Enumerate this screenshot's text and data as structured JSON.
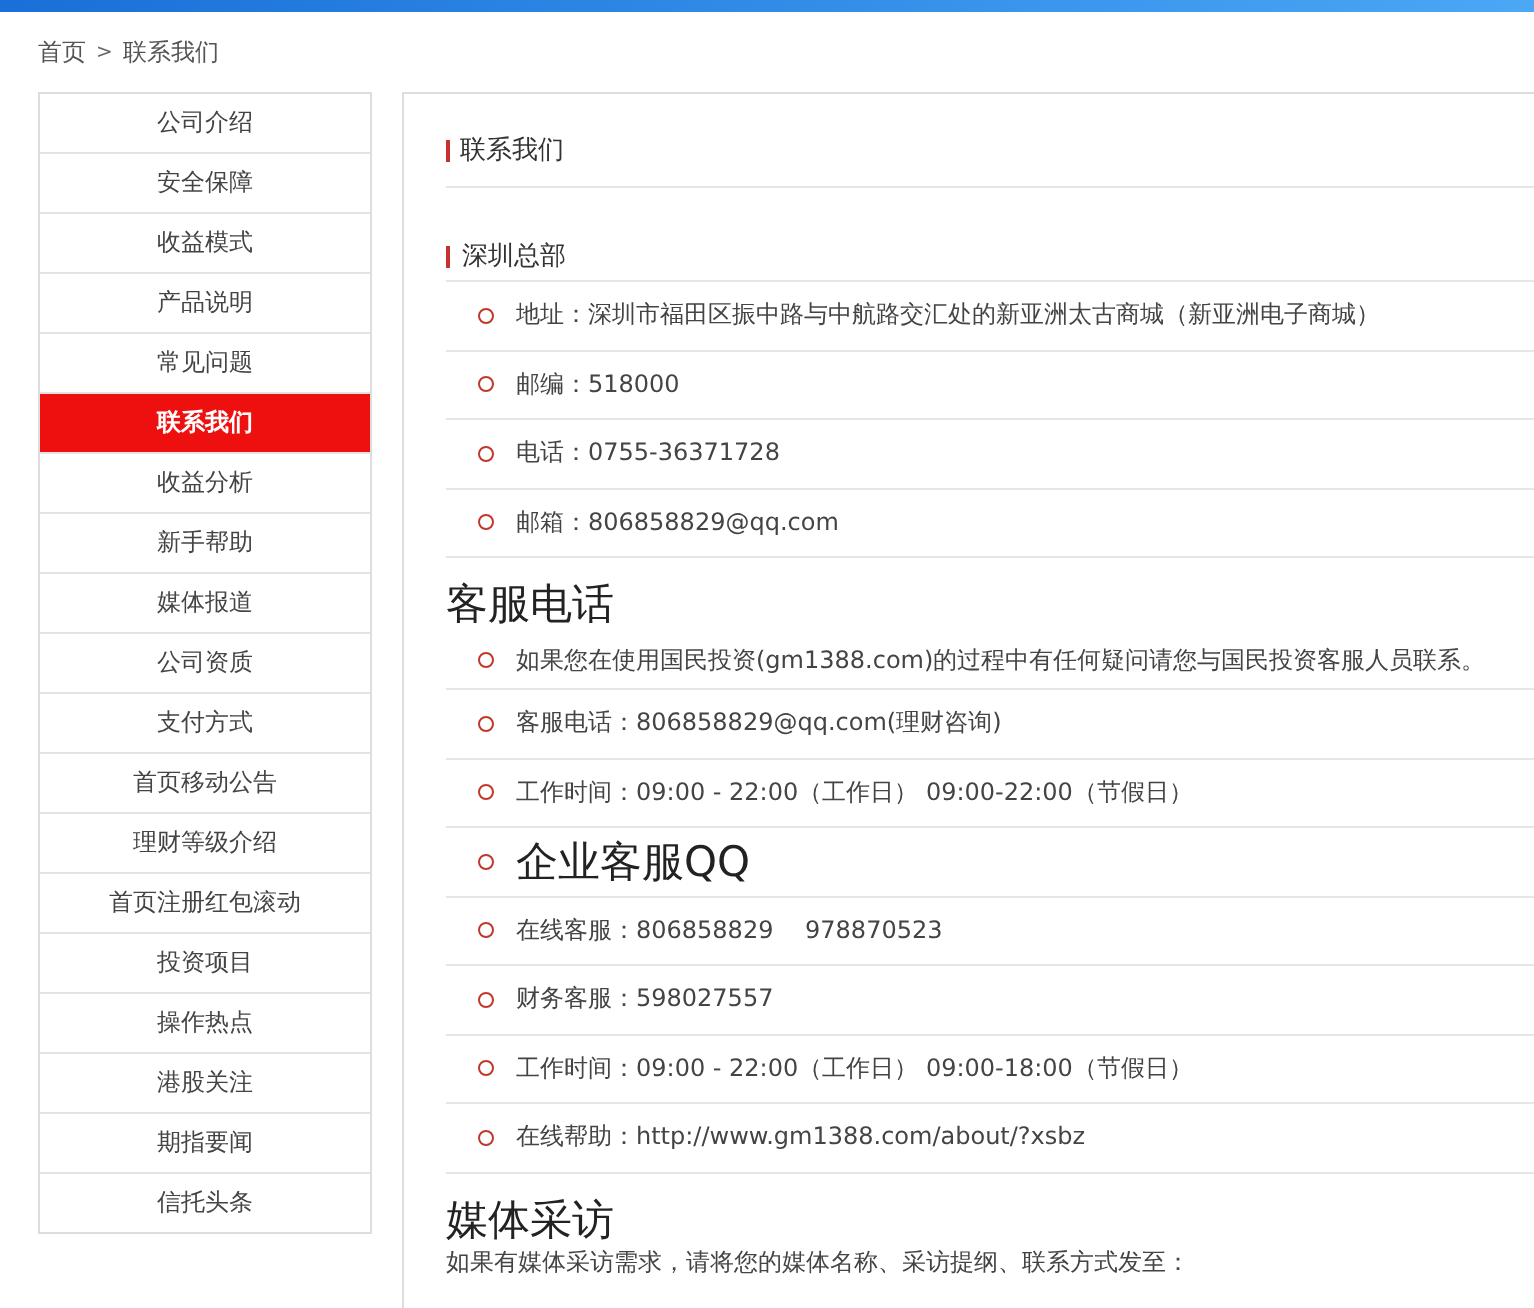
{
  "breadcrumb": [
    {
      "label": "首页"
    },
    {
      "label": "联系我们"
    }
  ],
  "breadcrumb_separator": ">",
  "sidebar": {
    "items": [
      {
        "label": "公司介绍",
        "selected": false
      },
      {
        "label": "安全保障",
        "selected": false
      },
      {
        "label": "收益模式",
        "selected": false
      },
      {
        "label": "产品说明",
        "selected": false
      },
      {
        "label": "常见问题",
        "selected": false
      },
      {
        "label": "联系我们",
        "selected": true
      },
      {
        "label": "收益分析",
        "selected": false
      },
      {
        "label": "新手帮助",
        "selected": false
      },
      {
        "label": "媒体报道",
        "selected": false
      },
      {
        "label": "公司资质",
        "selected": false
      },
      {
        "label": "支付方式",
        "selected": false
      },
      {
        "label": "首页移动公告",
        "selected": false
      },
      {
        "label": "理财等级介绍",
        "selected": false
      },
      {
        "label": "首页注册红包滚动",
        "selected": false
      },
      {
        "label": "投资项目",
        "selected": false
      },
      {
        "label": "操作热点",
        "selected": false
      },
      {
        "label": "港股关注",
        "selected": false
      },
      {
        "label": "期指要闻",
        "selected": false
      },
      {
        "label": "信托头条",
        "selected": false
      }
    ]
  },
  "panel_title": "联系我们",
  "sections": [
    {
      "title": "深圳总部",
      "kind": "bar",
      "items": [
        {
          "kind": "item",
          "text": "地址：深圳市福田区振中路与中航路交汇处的新亚洲太古商城（新亚洲电子商城）"
        },
        {
          "kind": "item",
          "text": "邮编：518000"
        },
        {
          "kind": "item",
          "text": "电话：0755-36371728"
        },
        {
          "kind": "item",
          "text": "邮箱：806858829@qq.com"
        }
      ]
    },
    {
      "title": "客服电话",
      "kind": "large",
      "items": [
        {
          "kind": "item",
          "text": "如果您在使用国民投资(gm1388.com)的过程中有任何疑问请您与国民投资客服人员联系。"
        },
        {
          "kind": "item",
          "text": "客服电话：806858829@qq.com(理财咨询)"
        },
        {
          "kind": "item",
          "text": "工作时间：09:00 - 22:00（工作日） 09:00-22:00（节假日）"
        },
        {
          "kind": "heading",
          "text": "企业客服QQ"
        },
        {
          "kind": "item",
          "text": "在线客服：806858829　 978870523"
        },
        {
          "kind": "item",
          "text": "财务客服：598027557"
        },
        {
          "kind": "item",
          "text": "工作时间：09:00 - 22:00（工作日） 09:00-18:00（节假日）"
        },
        {
          "kind": "item",
          "text": "在线帮助：http://www.gm1388.com/about/?xsbz"
        }
      ]
    },
    {
      "title": "媒体采访",
      "kind": "large",
      "paragraph": "如果有媒体采访需求，请将您的媒体名称、采访提纲、联系方式发至："
    }
  ]
}
